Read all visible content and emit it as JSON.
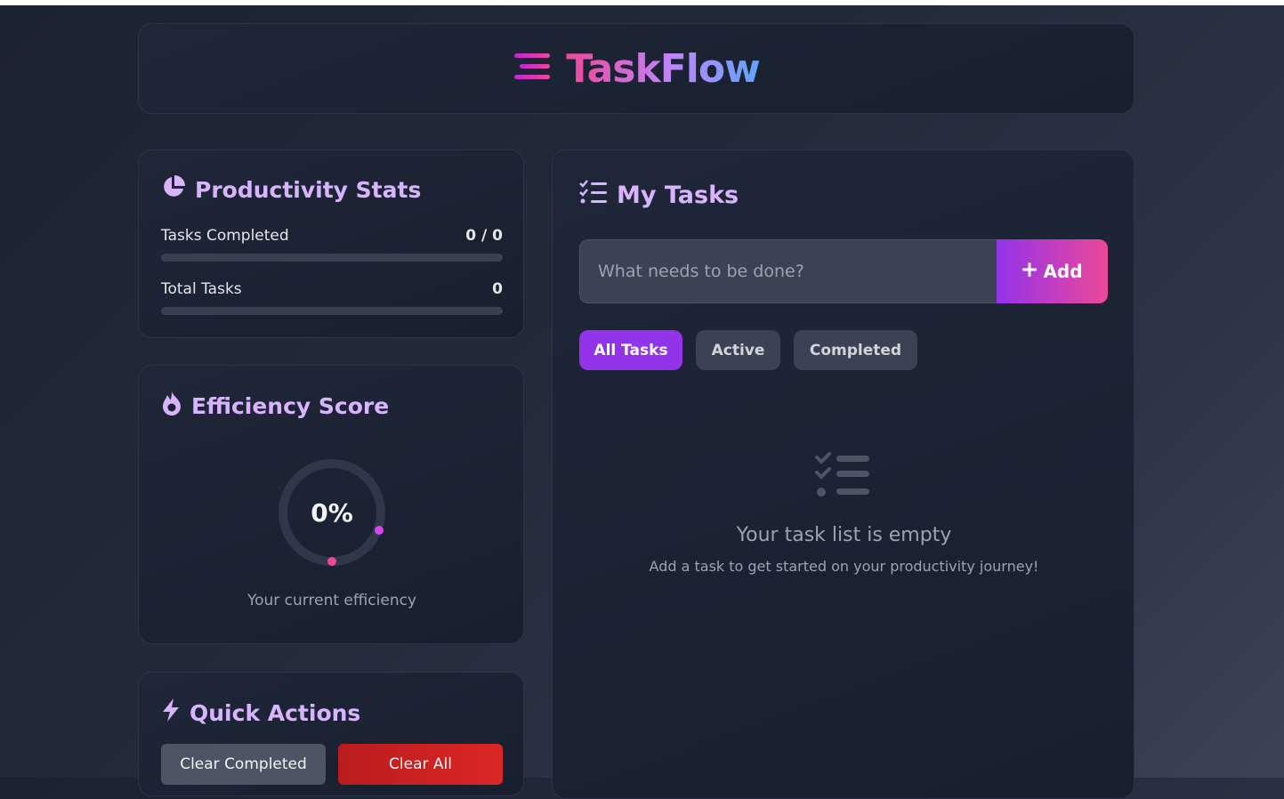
{
  "header": {
    "app_title": "TaskFlow",
    "logo_icon": "bars-icon"
  },
  "stats": {
    "title": "Productivity Stats",
    "icon": "pie-chart-icon",
    "rows": [
      {
        "label": "Tasks Completed",
        "value": "0 / 0",
        "progress": 0
      },
      {
        "label": "Total Tasks",
        "value": "0",
        "progress": 0
      }
    ]
  },
  "efficiency": {
    "title": "Efficiency Score",
    "icon": "fire-icon",
    "score": "0%",
    "caption": "Your current efficiency"
  },
  "quick_actions": {
    "title": "Quick Actions",
    "icon": "bolt-icon",
    "clear_completed": "Clear Completed",
    "clear_all": "Clear All"
  },
  "tasks": {
    "title": "My Tasks",
    "icon": "task-list-icon",
    "input_placeholder": "What needs to be done?",
    "add_label": "Add",
    "filters": [
      "All Tasks",
      "Active",
      "Completed"
    ],
    "active_filter": "All Tasks",
    "empty_title": "Your task list is empty",
    "empty_subtitle": "Add a task to get started on your productivity journey!"
  },
  "colors": {
    "accent": "#9333ea",
    "accent_pink": "#ec4899",
    "heading": "#d8b4fe",
    "danger": "#dc2626"
  }
}
